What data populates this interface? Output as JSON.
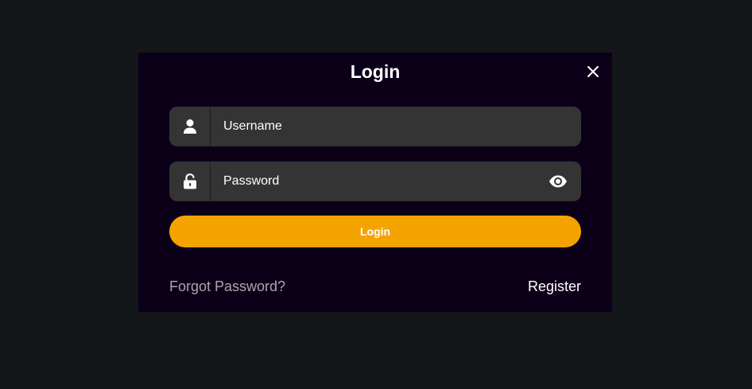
{
  "modal": {
    "title": "Login",
    "close_icon": "close-icon"
  },
  "username": {
    "placeholder": "Username",
    "icon": "user-icon"
  },
  "password": {
    "placeholder": "Password",
    "icon": "unlock-icon",
    "toggle_icon": "eye-icon"
  },
  "login_button": {
    "label": "Login"
  },
  "links": {
    "forgot_password": "Forgot Password?",
    "register": "Register"
  },
  "colors": {
    "background": "#14171a",
    "modal_background": "#0c0019",
    "field_background": "#343434",
    "accent": "#f5a300",
    "muted_link": "#a9a6ad"
  }
}
